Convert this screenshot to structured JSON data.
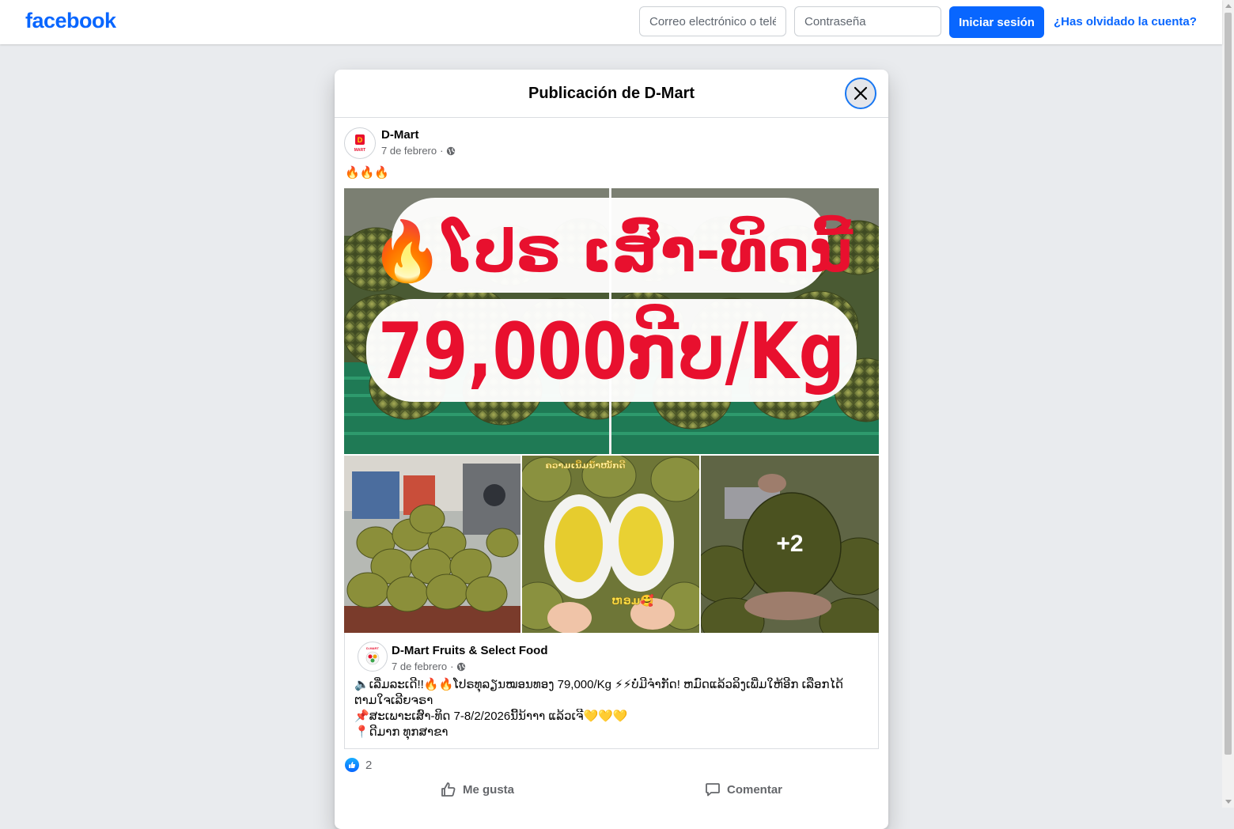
{
  "header": {
    "logo": "facebook",
    "email_placeholder": "Correo electrónico o teléfono",
    "password_placeholder": "Contraseña",
    "login_label": "Iniciar sesión",
    "forgot_label": "¿Has olvidado la cuenta?"
  },
  "dialog": {
    "title": "Publicación de D-Mart",
    "close_icon": "close-icon"
  },
  "post": {
    "author": "D-Mart",
    "date": "7 de febrero",
    "separator": "·",
    "audience_icon": "globe-icon",
    "text": "🔥🔥🔥",
    "images": {
      "banner_line1": "🔥ໂປຣ ເສົາ-ທິດນີ້",
      "banner_line2": "79,000ກີບ/Kg",
      "thumb2_caption_top": "ຄວາມເນີ້ມນ້ຳໜັກດີ",
      "thumb2_caption_bottom": "ຫອມ🥰",
      "more_count": "+2"
    }
  },
  "shared_post": {
    "author": "D-Mart Fruits & Select Food",
    "date": "7 de febrero",
    "separator": "·",
    "lines": [
      "🔈ເລີ່ມລະເດີ!!🔥🔥ໂປຣທຸລຽນໝອນທອງ  79,000/Kg ⚡⚡ບໍ່ມີຈຳກັດ! ຫມົດແລ້ວລິງເພີ່ມໃຫ້ອີກ ເລືອກໄດ້",
      "ຕາມໃຈເລີຍຈຣາ",
      "📌ສະເພາະເສົາ-ທິດ  7-8/2/2026ນີ້ນ້າາາ ແລ້ວເຈີ💛💛💛",
      "📍ດີມາກ ທຸກສາຂາ"
    ]
  },
  "reactions": {
    "like_icon": "like-icon",
    "count": "2"
  },
  "actions": {
    "like_label": "Me gusta",
    "comment_label": "Comentar"
  },
  "colors": {
    "brand_blue": "#0866ff",
    "banner_red": "#e8102e",
    "background": "#e9ebee"
  }
}
